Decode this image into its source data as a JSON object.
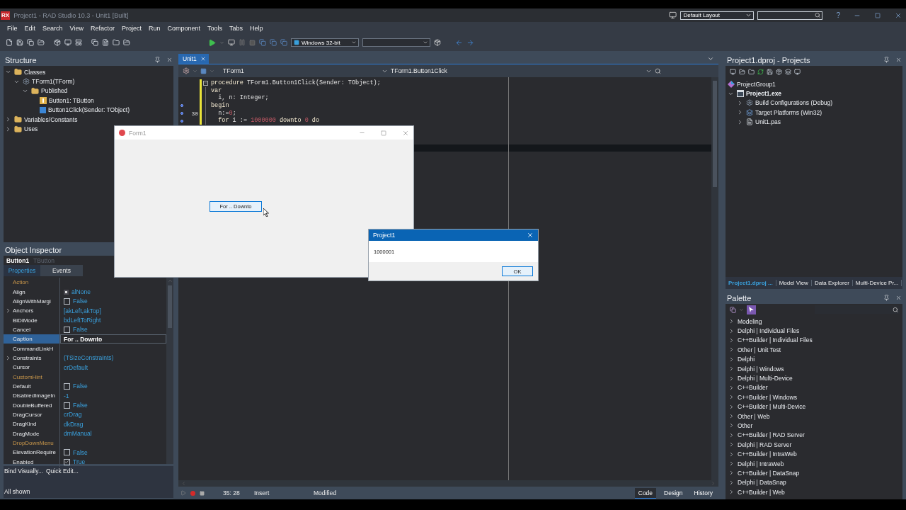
{
  "window": {
    "logo": "RX",
    "title": "Project1 - RAD Studio 10.3 - Unit1 [Built]",
    "layout": "Default Layout",
    "help": "?"
  },
  "menu": [
    "File",
    "Edit",
    "Search",
    "View",
    "Refactor",
    "Project",
    "Run",
    "Component",
    "Tools",
    "Tabs",
    "Help"
  ],
  "toolbar": {
    "platform": "Windows 32-bit"
  },
  "structure": {
    "title": "Structure",
    "tree": [
      {
        "label": "Classes",
        "kind": "folder",
        "expanded": true,
        "children": [
          {
            "label": "TForm1(TForm)",
            "kind": "class",
            "expanded": true,
            "children": [
              {
                "label": "Published",
                "kind": "folder",
                "expanded": true,
                "children": [
                  {
                    "label": "Button1: TButton",
                    "kind": "field"
                  },
                  {
                    "label": "Button1Click(Sender: TObject)",
                    "kind": "method"
                  }
                ]
              }
            ]
          }
        ]
      },
      {
        "label": "Variables/Constants",
        "kind": "folder",
        "expanded": false
      },
      {
        "label": "Uses",
        "kind": "folder",
        "expanded": false
      }
    ]
  },
  "object_inspector": {
    "title": "Object Inspector",
    "component": "Button1",
    "component_type": "TButton",
    "tabs": [
      {
        "label": "Properties",
        "selected": true
      },
      {
        "label": "Events",
        "selected": false
      }
    ],
    "properties": [
      {
        "name": "Action",
        "kind": "empty",
        "linked": true,
        "selected": false
      },
      {
        "name": "Align",
        "kind": "radio",
        "value": "alNone",
        "linked": false,
        "selected": false
      },
      {
        "name": "AlignWithMargi",
        "kind": "check",
        "checked": false,
        "value": "False",
        "linked": false,
        "selected": false
      },
      {
        "name": "Anchors",
        "kind": "text",
        "value": "[akLeft,akTop]",
        "linked": false,
        "expanded": false,
        "selected": false
      },
      {
        "name": "BiDiMode",
        "kind": "text",
        "value": "bdLeftToRight",
        "linked": false,
        "selected": false
      },
      {
        "name": "Cancel",
        "kind": "check",
        "checked": false,
        "value": "False",
        "linked": false,
        "selected": false
      },
      {
        "name": "Caption",
        "kind": "text",
        "value": "For .. Downto",
        "linked": false,
        "selected": true
      },
      {
        "name": "CommandLinkH",
        "kind": "empty",
        "linked": false,
        "selected": false
      },
      {
        "name": "Constraints",
        "kind": "text",
        "value": "(TSizeConstraints)",
        "linked": false,
        "expanded": false,
        "selected": false
      },
      {
        "name": "Cursor",
        "kind": "text",
        "value": "crDefault",
        "linked": false,
        "selected": false
      },
      {
        "name": "CustomHint",
        "kind": "empty",
        "linked": true,
        "selected": false
      },
      {
        "name": "Default",
        "kind": "check",
        "checked": false,
        "value": "False",
        "linked": false,
        "selected": false
      },
      {
        "name": "DisabledImageIn",
        "kind": "text",
        "value": "-1",
        "linked": false,
        "selected": false
      },
      {
        "name": "DoubleBuffered",
        "kind": "check",
        "checked": false,
        "value": "False",
        "linked": false,
        "selected": false
      },
      {
        "name": "DragCursor",
        "kind": "text",
        "value": "crDrag",
        "linked": false,
        "selected": false
      },
      {
        "name": "DragKind",
        "kind": "text",
        "value": "dkDrag",
        "linked": false,
        "selected": false
      },
      {
        "name": "DragMode",
        "kind": "text",
        "value": "dmManual",
        "linked": false,
        "selected": false
      },
      {
        "name": "DropDownMenu",
        "kind": "empty",
        "linked": true,
        "selected": false
      },
      {
        "name": "ElevationRequire",
        "kind": "check",
        "checked": false,
        "value": "False",
        "linked": false,
        "selected": false
      },
      {
        "name": "Enabled",
        "kind": "check",
        "checked": true,
        "value": "True",
        "linked": false,
        "selected": false
      }
    ],
    "links": [
      "Bind Visually...",
      "Quick Edit..."
    ],
    "status": "All shown"
  },
  "editor": {
    "tabs": [
      {
        "label": "Unit1",
        "selected": true
      }
    ],
    "class_box": "TForm1",
    "method_box": "TForm1.Button1Click",
    "lines": [
      {
        "marker": false,
        "fold": true,
        "tokens": [
          {
            "text": "procedure",
            "kind": "keyword"
          },
          {
            "text": " TForm1.Button1Click(Sender: TObject);",
            "kind": "plain"
          }
        ]
      },
      {
        "marker": false,
        "fold": false,
        "tokens": [
          {
            "text": "var",
            "kind": "keyword"
          }
        ]
      },
      {
        "marker": false,
        "fold": false,
        "tokens": [
          {
            "text": "  i, n: Integer;",
            "kind": "plain"
          }
        ]
      },
      {
        "marker": true,
        "fold": false,
        "tokens": [
          {
            "text": "begin",
            "kind": "keyword"
          }
        ]
      },
      {
        "number": "30",
        "marker": true,
        "fold": false,
        "tokens": [
          {
            "text": "  n:=",
            "kind": "plain"
          },
          {
            "text": "0",
            "kind": "number"
          },
          {
            "text": ";",
            "kind": "plain"
          }
        ]
      },
      {
        "marker": true,
        "fold": false,
        "tokens": [
          {
            "text": "  for",
            "kind": "keyword"
          },
          {
            "text": " i := ",
            "kind": "plain"
          },
          {
            "text": "1000000",
            "kind": "number"
          },
          {
            "text": " downto ",
            "kind": "keyword"
          },
          {
            "text": "0",
            "kind": "number"
          },
          {
            "text": " do",
            "kind": "keyword"
          }
        ]
      }
    ],
    "position": "35: 28",
    "mode": "Insert",
    "state": "Modified",
    "views": [
      {
        "label": "Code",
        "selected": true
      },
      {
        "label": "Design",
        "selected": false
      },
      {
        "label": "History",
        "selected": false
      }
    ]
  },
  "projects": {
    "title": "Project1.dproj - Projects",
    "tree": [
      {
        "label": "ProjectGroup1",
        "kind": "group",
        "children": [
          {
            "label": "Project1.exe",
            "kind": "project",
            "expanded": true,
            "children": [
              {
                "label": "Build Configurations (Debug)",
                "kind": "config",
                "expanded": false
              },
              {
                "label": "Target Platforms (Win32)",
                "kind": "platform",
                "expanded": false
              },
              {
                "label": "Unit1.pas",
                "kind": "file",
                "expanded": false
              }
            ]
          }
        ]
      }
    ],
    "tabs": [
      {
        "label": "Project1.dproj ...",
        "selected": true
      },
      {
        "label": "Model View",
        "selected": false
      },
      {
        "label": "Data Explorer",
        "selected": false
      },
      {
        "label": "Multi-Device Pr...",
        "selected": false
      }
    ]
  },
  "palette": {
    "title": "Palette",
    "items": [
      {
        "label": "Modeling",
        "expanded": false
      },
      {
        "label": "Delphi | Individual Files",
        "expanded": false
      },
      {
        "label": "C++Builder | Individual Files",
        "expanded": false
      },
      {
        "label": "Other | Unit Test",
        "expanded": false
      },
      {
        "label": "Delphi",
        "expanded": false
      },
      {
        "label": "Delphi | Windows",
        "expanded": false
      },
      {
        "label": "Delphi | Multi-Device",
        "expanded": false
      },
      {
        "label": "C++Builder",
        "expanded": false
      },
      {
        "label": "C++Builder | Windows",
        "expanded": false
      },
      {
        "label": "C++Builder | Multi-Device",
        "expanded": false
      },
      {
        "label": "Other | Web",
        "expanded": false
      },
      {
        "label": "Other",
        "expanded": false
      },
      {
        "label": "C++Builder | RAD Server",
        "expanded": false
      },
      {
        "label": "Delphi | RAD Server",
        "expanded": false
      },
      {
        "label": "C++Builder | IntraWeb",
        "expanded": false
      },
      {
        "label": "Delphi | IntraWeb",
        "expanded": false
      },
      {
        "label": "C++Builder | DataSnap",
        "expanded": false
      },
      {
        "label": "Delphi | DataSnap",
        "expanded": false
      },
      {
        "label": "C++Builder | Web",
        "expanded": false
      }
    ]
  },
  "form_window": {
    "title": "Form1",
    "button": "For .. Downto"
  },
  "dialog": {
    "title": "Project1",
    "message": "1000001",
    "button": "OK"
  }
}
